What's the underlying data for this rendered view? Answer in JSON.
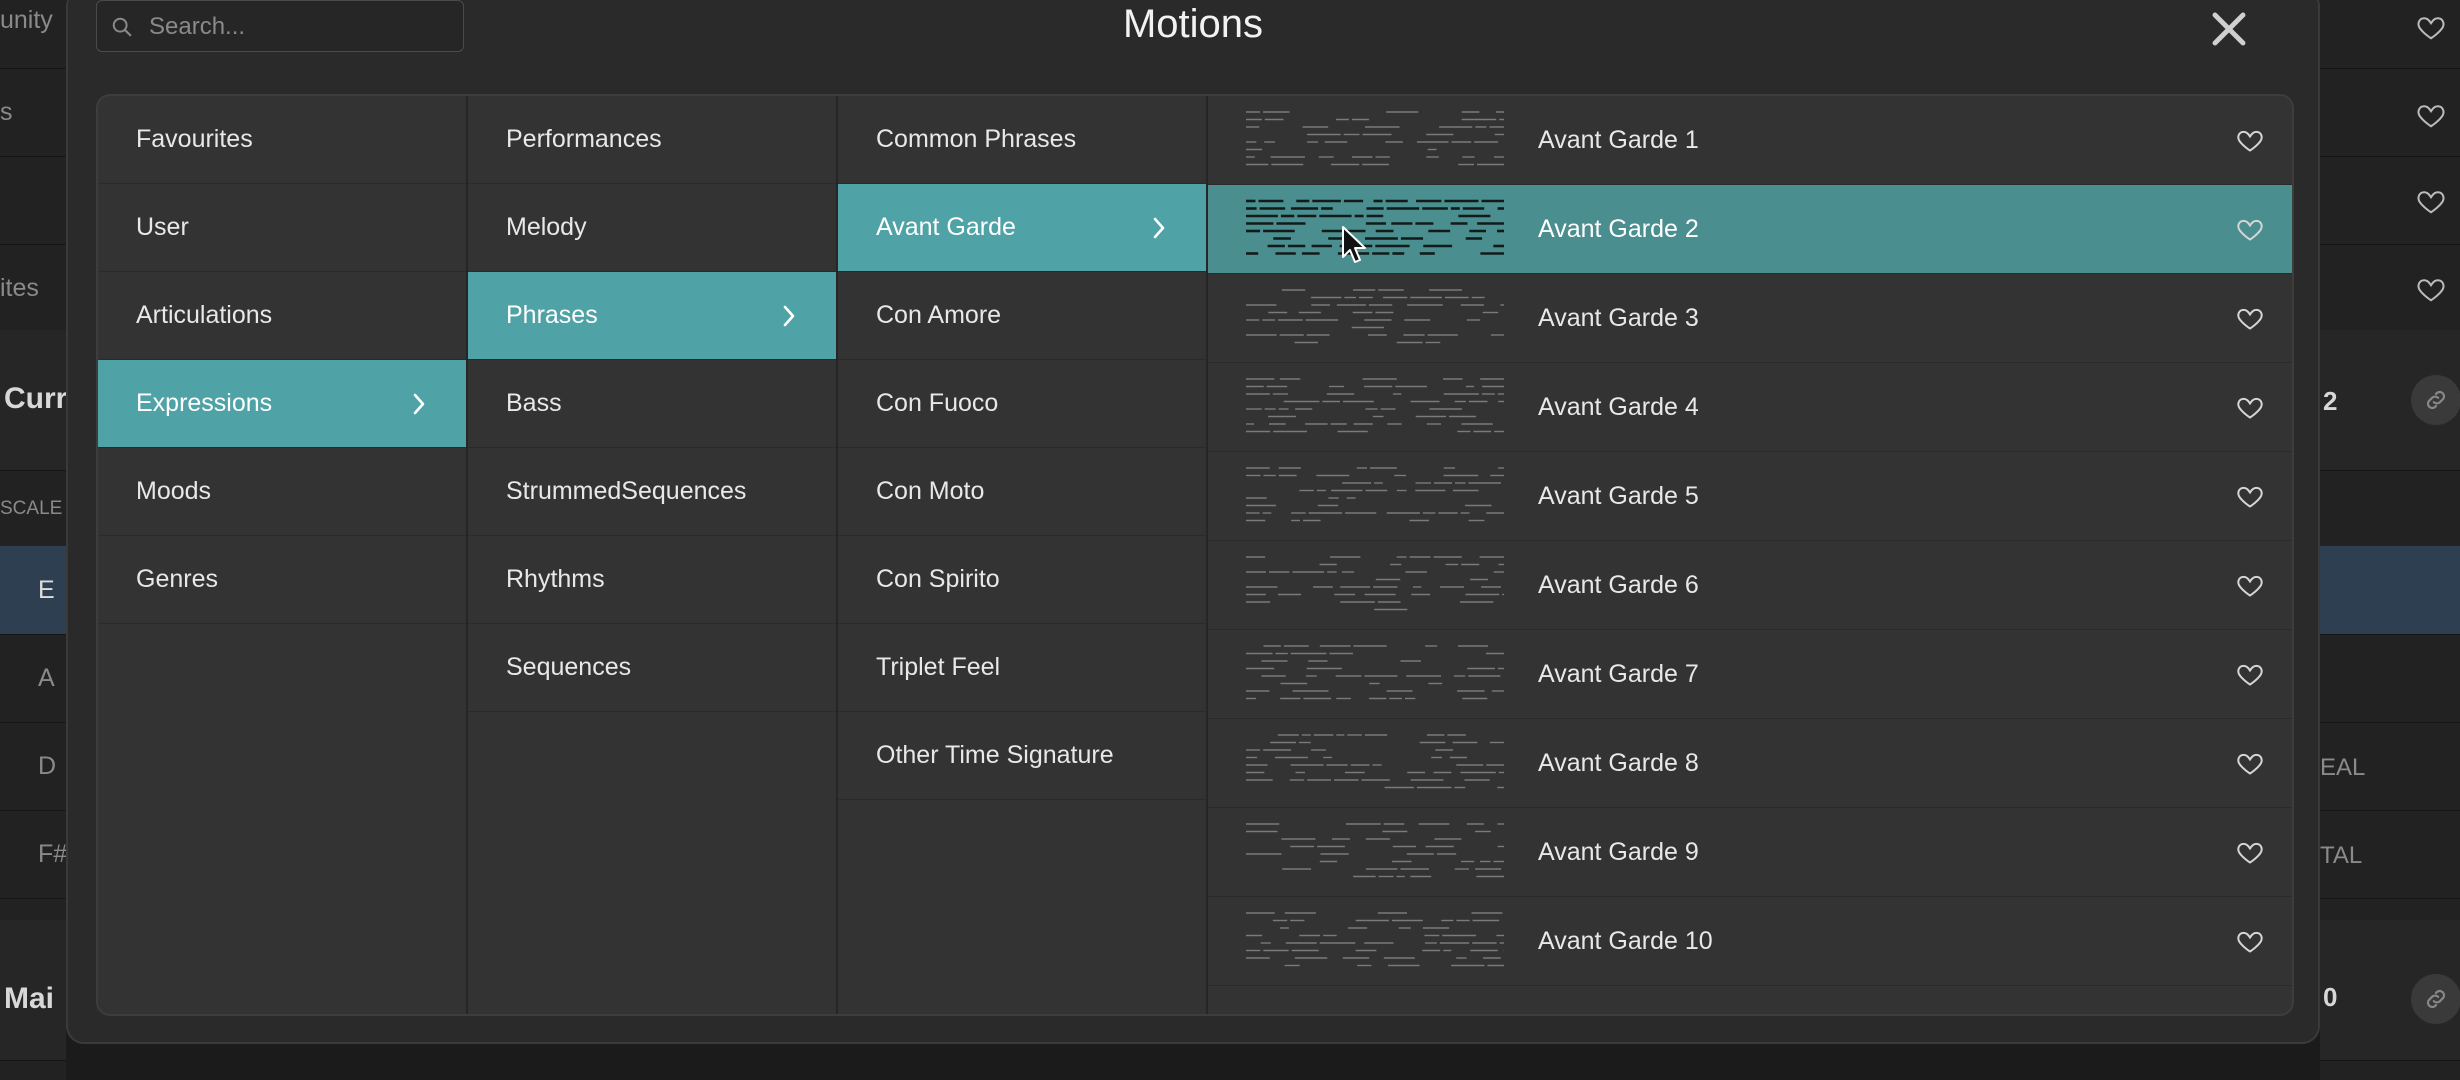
{
  "background": {
    "left_snippets": [
      "unity",
      "s",
      "ites",
      "Curr",
      "SCALE",
      "E",
      "A",
      "D",
      "F#",
      "Mai"
    ],
    "right_snippets": [
      "2",
      "EAL",
      "TAL",
      "0"
    ]
  },
  "modal": {
    "title": "Motions",
    "search_placeholder": "Search..."
  },
  "categories": [
    {
      "label": "Favourites"
    },
    {
      "label": "User"
    },
    {
      "label": "Articulations"
    },
    {
      "label": "Expressions",
      "selected": true
    },
    {
      "label": "Moods"
    },
    {
      "label": "Genres"
    }
  ],
  "subcategories": [
    {
      "label": "Performances"
    },
    {
      "label": "Melody"
    },
    {
      "label": "Phrases",
      "selected": true
    },
    {
      "label": "Bass"
    },
    {
      "label": "StrummedSequences"
    },
    {
      "label": "Rhythms"
    },
    {
      "label": "Sequences"
    }
  ],
  "phrases": [
    {
      "label": "Common Phrases"
    },
    {
      "label": "Avant Garde",
      "selected": true
    },
    {
      "label": "Con Amore"
    },
    {
      "label": "Con Fuoco"
    },
    {
      "label": "Con Moto"
    },
    {
      "label": "Con Spirito"
    },
    {
      "label": "Triplet Feel"
    },
    {
      "label": "Other Time Signature"
    }
  ],
  "motions": [
    {
      "name": "Avant Garde 1"
    },
    {
      "name": "Avant Garde 2",
      "selected": true
    },
    {
      "name": "Avant Garde 3"
    },
    {
      "name": "Avant Garde 4"
    },
    {
      "name": "Avant Garde 5"
    },
    {
      "name": "Avant Garde 6"
    },
    {
      "name": "Avant Garde 7"
    },
    {
      "name": "Avant Garde 8"
    },
    {
      "name": "Avant Garde 9"
    },
    {
      "name": "Avant Garde 10"
    }
  ],
  "colors": {
    "accent": "#4fa3a6",
    "accent_row": "#4a8e90",
    "panel": "#333333",
    "modal": "#2a2a2a"
  },
  "icons": {
    "search": "search-icon",
    "close": "close-icon",
    "chevron": "chevron-right-icon",
    "favourite": "heart-icon",
    "link": "link-icon"
  }
}
